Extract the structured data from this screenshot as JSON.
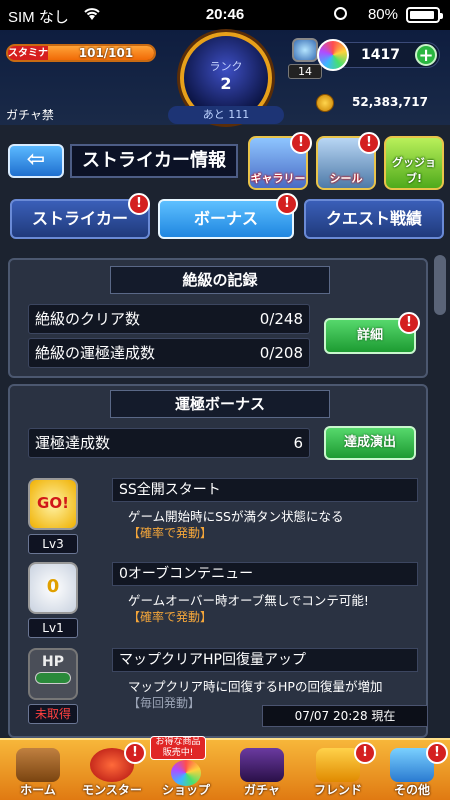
{
  "status_bar": {
    "carrier": "SIM なし",
    "time": "20:46",
    "battery": "80%"
  },
  "hud": {
    "stamina_label": "スタミナ",
    "stamina": "101/101",
    "stamina_fraction": 1.0,
    "rank_label": "ランク",
    "rank": "2",
    "gacha_ban": "ガチャ禁",
    "rank_remaining": "あと 111",
    "orb_badge_count": "14",
    "orbs": "1417",
    "gold": "52,383,717"
  },
  "header": {
    "title": "ストライカー情報",
    "gallery_label": "ギャラリー",
    "seal_label": "シール",
    "goods_label": "グッジョブ!"
  },
  "tabs": [
    {
      "label": "ストライカー",
      "active": false
    },
    {
      "label": "ボーナス",
      "active": true
    },
    {
      "label": "クエスト戦績",
      "active": false
    }
  ],
  "extreme": {
    "header": "絶級の記録",
    "clear_label": "絶級のクリア数",
    "clear_value": "0/248",
    "luck_label": "絶級の運極達成数",
    "luck_value": "0/208",
    "detail_button": "詳細"
  },
  "luck_bonus": {
    "header": "運極ボーナス",
    "count_label": "運極達成数",
    "count_value": "6",
    "effect_button": "達成演出",
    "items": [
      {
        "badge": "GO!",
        "level": "Lv3",
        "name": "SS全開スタート",
        "description": "ゲーム開始時にSSが満タン状態になる",
        "condition": "【確率で発動】"
      },
      {
        "badge": "0",
        "level": "Lv1",
        "name": "0オーブコンテニュー",
        "description": "ゲームオーバー時オーブ無しでコンテ可能!",
        "condition": "【確率で発動】"
      },
      {
        "badge": "HP",
        "level": "未取得",
        "name": "マップクリアHP回復量アップ",
        "description": "マップクリア時に回復するHPの回復量が増加",
        "condition": "【毎回発動】"
      }
    ]
  },
  "timestamp": "07/07 20:28 現在",
  "bottom_nav": {
    "deal_badge": "お得な商品\n販売中!",
    "items": [
      "ホーム",
      "モンスター",
      "ショップ",
      "ガチャ",
      "フレンド",
      "その他"
    ]
  },
  "colors": {
    "accent_orange": "#f09020",
    "tab_blue": "#1f86e0",
    "button_green": "#1d9b32",
    "alert_red": "#d42020"
  }
}
